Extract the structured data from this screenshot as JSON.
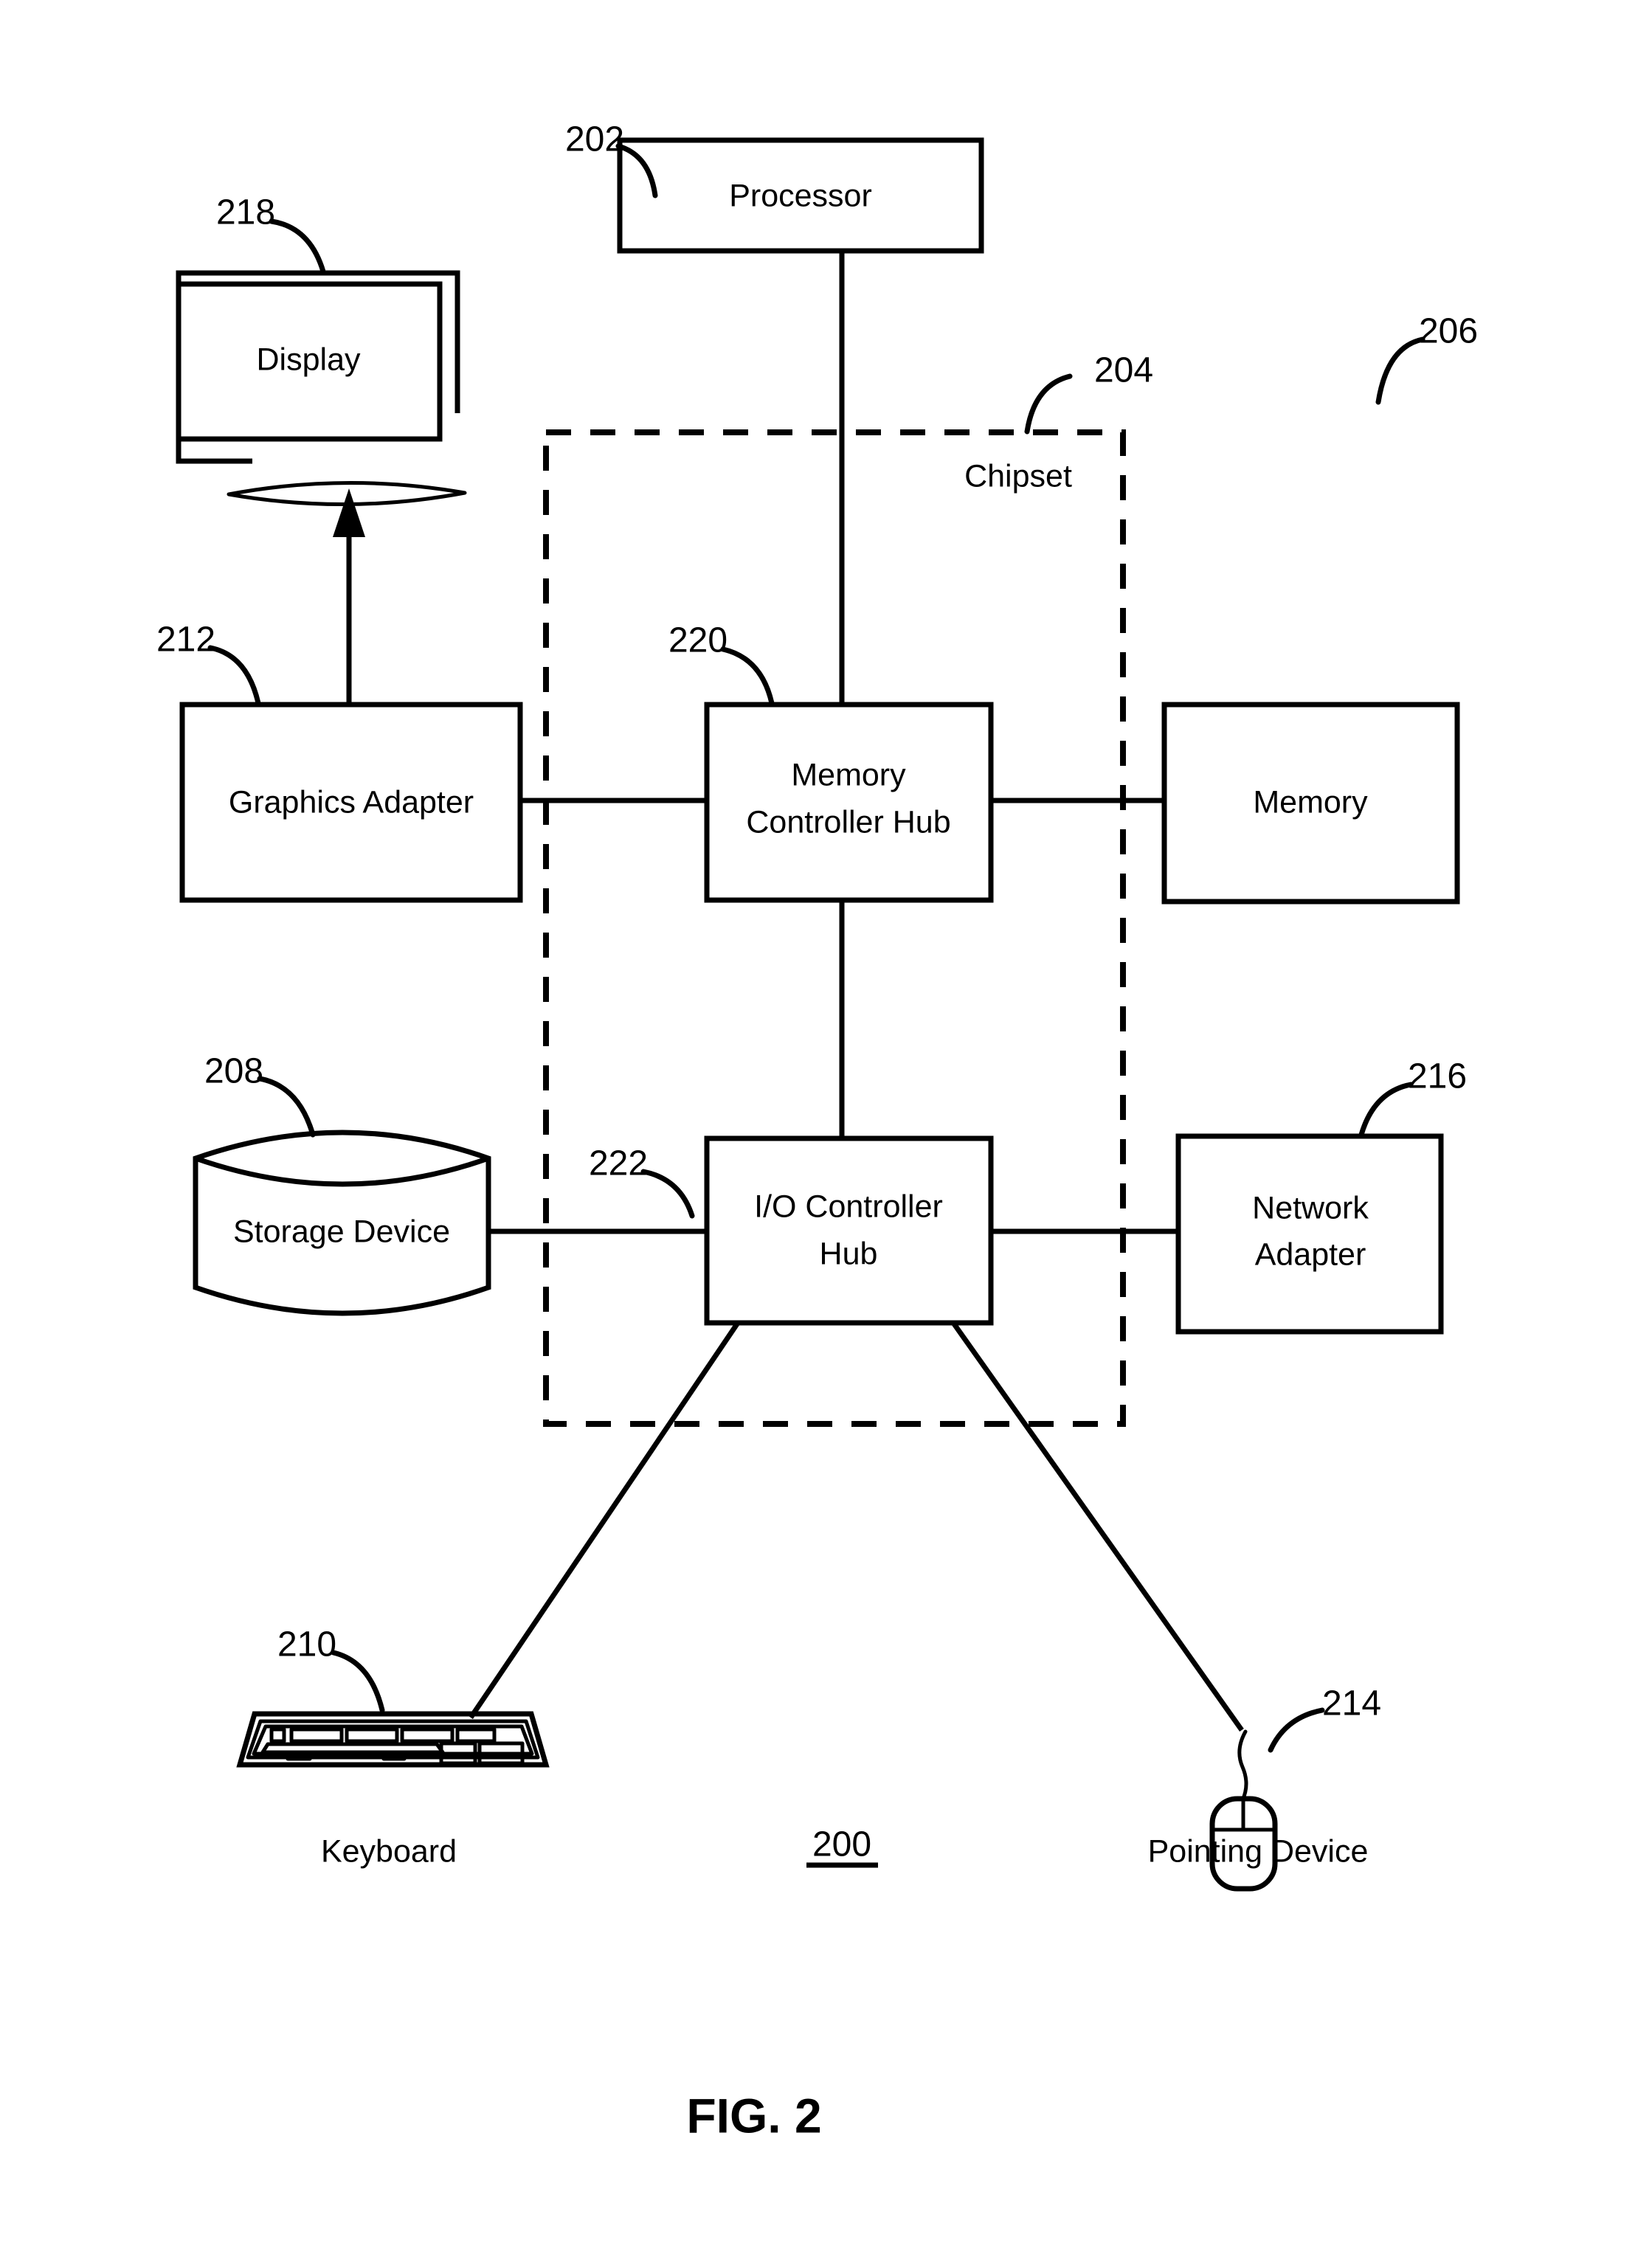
{
  "figure": {
    "caption": "FIG. 2",
    "system_ref": "200"
  },
  "nodes": {
    "processor": {
      "label": "Processor",
      "ref": "202"
    },
    "chipset": {
      "label": "Chipset",
      "ref": "204"
    },
    "memory": {
      "label": "Memory",
      "ref": "206"
    },
    "storage_device": {
      "label": "Storage Device",
      "ref": "208"
    },
    "keyboard": {
      "label": "Keyboard",
      "ref": "210"
    },
    "graphics_adapter": {
      "label": "Graphics Adapter",
      "ref": "212"
    },
    "pointing_device": {
      "label": "Pointing Device",
      "ref": "214"
    },
    "network_adapter": {
      "label_line1": "Network",
      "label_line2": "Adapter",
      "ref": "216"
    },
    "display": {
      "label": "Display",
      "ref": "218"
    },
    "memory_controller_hub": {
      "label_line1": "Memory",
      "label_line2": "Controller Hub",
      "ref": "220"
    },
    "io_controller_hub": {
      "label_line1": "I/O Controller",
      "label_line2": "Hub",
      "ref": "222"
    }
  },
  "colors": {
    "ink": "#000000",
    "paper": "#ffffff"
  }
}
